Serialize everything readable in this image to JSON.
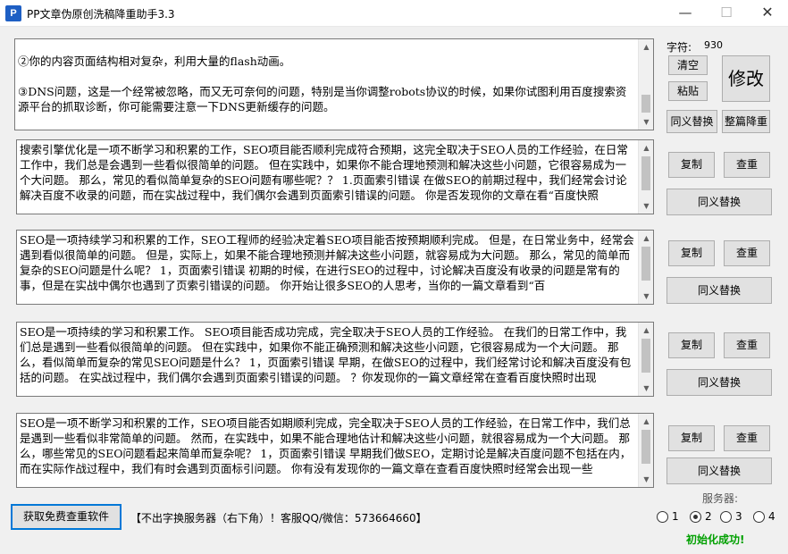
{
  "window": {
    "title": "PP文章伪原创洗稿降重助手3.3",
    "minimize_glyph": "—",
    "maximize_glyph": "☐",
    "close_glyph": "✕"
  },
  "main_text": "②你的内容页面结构相对复杂，利用大量的flash动画。\n\n③DNS问题，这是一个经常被忽略，而又无可奈何的问题，特别是当你调整robots协议的时候，如果你试图利用百度搜索资源平台的抓取诊断，你可能需要注意一下DNS更新缓存的问题。",
  "char_count": {
    "label": "字符:",
    "value": "930"
  },
  "buttons": {
    "clear": "清空",
    "paste": "粘贴",
    "modify": "修改",
    "synonym_replace": "同义替换",
    "whole_reduce": "整篇降重",
    "copy": "复制",
    "check": "查重",
    "synonym": "同义替换",
    "get_software": "获取免费查重软件"
  },
  "results": [
    "搜索引擎优化是一项不断学习和积累的工作，SEO项目能否顺利完成符合预期，这完全取决于SEO人员的工作经验，在日常工作中，我们总是会遇到一些看似很简单的问题。 但在实践中，如果你不能合理地预测和解决这些小问题，它很容易成为一个大问题。 那么，常见的看似简单复杂的SEO问题有哪些呢？？ 1.页面索引错误 在做SEO的前期过程中，我们经常会讨论解决百度不收录的问题，而在实战过程中，我们偶尔会遇到页面索引错误的问题。 你是否发现你的文章在看“百度快照",
    "SEO是一项持续学习和积累的工作，SEO工程师的经验决定着SEO项目能否按预期顺利完成。 但是，在日常业务中，经常会遇到看似很简单的问题。 但是，实际上，如果不能合理地预测并解决这些小问题，就容易成为大问题。 那么，常见的简单而复杂的SEO问题是什么呢？ 1，页面索引错误 初期的时候，在进行SEO的过程中，讨论解决百度没有收录的问题是常有的事，但是在实战中偶尔也遇到了页索引错误的问题。 你开始让很多SEO的人思考，当你的一篇文章看到“百",
    "SEO是一项持续的学习和积累工作。 SEO项目能否成功完成，完全取决于SEO人员的工作经验。 在我们的日常工作中，我们总是遇到一些看似很简单的问题。 但在实践中，如果你不能正确预测和解决这些小问题，它很容易成为一个大问题。 那么，看似简单而复杂的常见SEO问题是什么？ 1，页面索引错误 早期，在做SEO的过程中，我们经常讨论和解决百度没有包括的问题。 在实战过程中，我们偶尔会遇到页面索引错误的问题。 ？你发现你的一篇文章经常在查看百度快照时出现",
    "SEO是一项不断学习和积累的工作，SEO项目能否如期顺利完成，完全取决于SEO人员的工作经验，在日常工作中，我们总是遇到一些看似非常简单的问题。 然而，在实践中，如果不能合理地估计和解决这些小问题，就很容易成为一个大问题。 那么，哪些常见的SEO问题看起来简单而复杂呢？ 1，页面索引错误 早期我们做SEO，定期讨论是解决百度问题不包括在内，而在实际作战过程中，我们有时会遇到页面标引问题。 你有没有发现你的一篇文章在查看百度快照时经常会出现一些"
  ],
  "footer": {
    "notice": "【不出字换服务器（右下角）！客服QQ/微信：573664660】",
    "server_label": "服务器:",
    "servers": [
      "1",
      "2",
      "3",
      "4"
    ],
    "selected_server": "2",
    "status": "初始化成功!",
    "status_color": "#00a000"
  },
  "colors": {
    "focus_border": "#0078d7",
    "app_icon": "#1e5fc4"
  }
}
